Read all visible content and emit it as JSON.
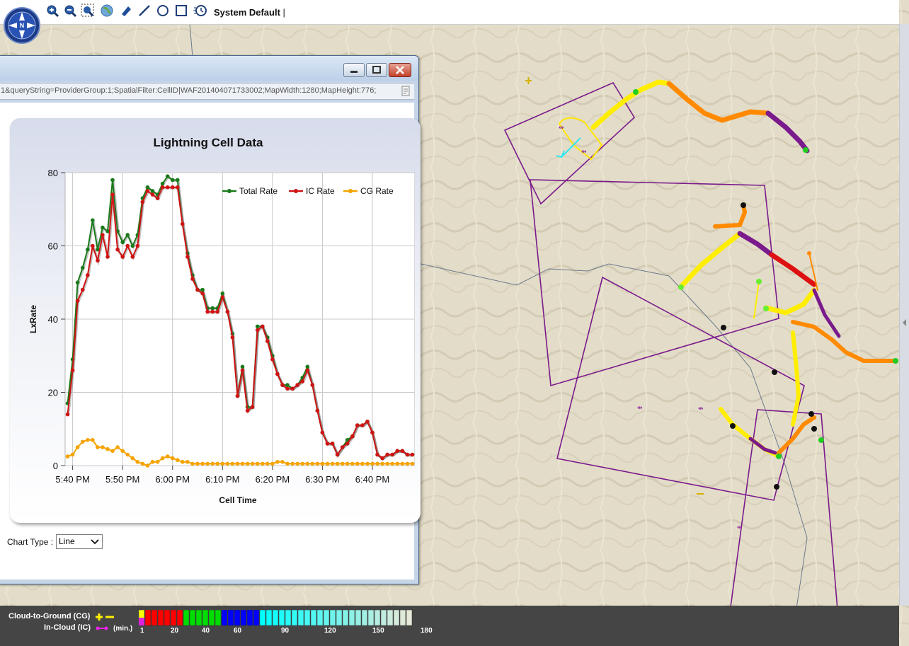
{
  "toolbar": {
    "icons": [
      "compass-icon",
      "zoom-in-icon",
      "zoom-out-icon",
      "zoom-box-icon",
      "globe-icon",
      "eraser-icon",
      "draw-line-icon",
      "draw-circle-icon",
      "draw-rectangle-icon",
      "clock-icon"
    ],
    "profile_label": "System Default",
    "cursor": "|"
  },
  "window": {
    "address": "1&queryString=ProviderGroup:1;SpatialFilter:CellID|WAF201404071733002;MapWidth:1280;MapHeight:776;",
    "controls": [
      "minimize-icon",
      "restore-icon",
      "close-icon"
    ],
    "chart_type_label": "Chart Type :",
    "chart_type_value": "Line"
  },
  "chart_data": {
    "type": "line",
    "title": "Lightning Cell Data",
    "xlabel": "Cell Time",
    "ylabel": "LxRate",
    "ylim": [
      0,
      80
    ],
    "yticks": [
      0,
      20,
      40,
      60,
      80
    ],
    "xtick_labels": [
      "5:40 PM",
      "5:50 PM",
      "6:00 PM",
      "6:10 PM",
      "6:20 PM",
      "6:30 PM",
      "6:40 PM"
    ],
    "x_minutes_range": [
      338.5,
      408.5
    ],
    "grid": true,
    "legend_position": "top-right",
    "x": [
      339,
      340,
      341,
      342,
      343,
      344,
      345,
      346,
      347,
      348,
      349,
      350,
      351,
      352,
      353,
      354,
      355,
      356,
      357,
      358,
      359,
      360,
      361,
      362,
      363,
      364,
      365,
      366,
      367,
      368,
      369,
      370,
      371,
      372,
      373,
      374,
      375,
      376,
      377,
      378,
      379,
      380,
      381,
      382,
      383,
      384,
      385,
      386,
      387,
      388,
      389,
      390,
      391,
      392,
      393,
      394,
      395,
      396,
      397,
      398,
      399,
      400,
      401,
      402,
      403,
      404,
      405,
      406,
      407,
      408
    ],
    "series": [
      {
        "name": "Total Rate",
        "color": "#1a7a1a",
        "values": [
          17,
          29,
          50,
          54,
          59,
          67,
          59,
          65,
          64,
          78,
          64,
          61,
          63,
          60,
          63,
          73,
          76,
          75,
          74,
          77,
          79,
          78,
          78,
          66,
          58,
          52,
          48,
          48,
          43,
          43,
          43,
          47,
          42,
          36,
          19,
          27,
          16,
          16,
          38,
          38,
          35,
          30,
          25,
          22,
          22,
          21,
          22,
          24,
          27,
          22,
          15,
          9,
          6,
          6,
          3,
          5,
          7,
          8,
          11,
          11,
          12,
          9,
          3,
          2,
          3,
          3,
          4,
          4,
          3,
          3
        ],
        "values_true_tail": []
      },
      {
        "name": "IC Rate",
        "color": "#d01414",
        "values": [
          14,
          26,
          45,
          48,
          52,
          60,
          56,
          63,
          57,
          74,
          59,
          57,
          60,
          57,
          60,
          72,
          75,
          74,
          73,
          76,
          76,
          76,
          76,
          66,
          57,
          51,
          48,
          47,
          42,
          42,
          42,
          46,
          42,
          35,
          19,
          26,
          15,
          16,
          37,
          38,
          34,
          29,
          25,
          22,
          21,
          21,
          22,
          23,
          26,
          22,
          15,
          9,
          6,
          6,
          3,
          5,
          6,
          8,
          11,
          11,
          12,
          9,
          3,
          2,
          3,
          3,
          4,
          4,
          3,
          3
        ]
      },
      {
        "name": "CG Rate",
        "color": "#f5a300",
        "values": [
          2.5,
          3,
          5,
          6.5,
          7,
          7,
          5,
          5,
          4.5,
          4,
          5,
          4,
          3,
          2,
          1,
          0.5,
          0,
          1,
          1,
          2,
          2.5,
          2,
          1.5,
          1,
          1,
          0.5,
          0.5,
          0.5,
          0.5,
          0.5,
          0.5,
          0.5,
          0.5,
          0.5,
          0.5,
          0.5,
          0.5,
          0.5,
          0.5,
          0.5,
          0.5,
          0.5,
          1,
          1,
          0.5,
          0.5,
          0.5,
          0.5,
          0.5,
          0.5,
          0.5,
          0.5,
          0.5,
          0.5,
          0.5,
          0.5,
          0.5,
          0.5,
          0.5,
          0.5,
          0.5,
          0.5,
          0.5,
          0.5,
          0.5,
          0.5,
          0.5,
          0.5,
          0.5,
          0.5
        ]
      }
    ]
  },
  "legend": {
    "cg_label": "Cloud-to-Ground (CG)",
    "ic_label": "In-Cloud (IC)",
    "units_label": "(min.)",
    "ticks": [
      "1",
      "20",
      "40",
      "60",
      "90",
      "120",
      "150",
      "180"
    ],
    "colors": [
      "#ffff00",
      "#ff0000",
      "#00dd00",
      "#0000ff",
      "#00ffff",
      "#e8e8d8"
    ]
  }
}
